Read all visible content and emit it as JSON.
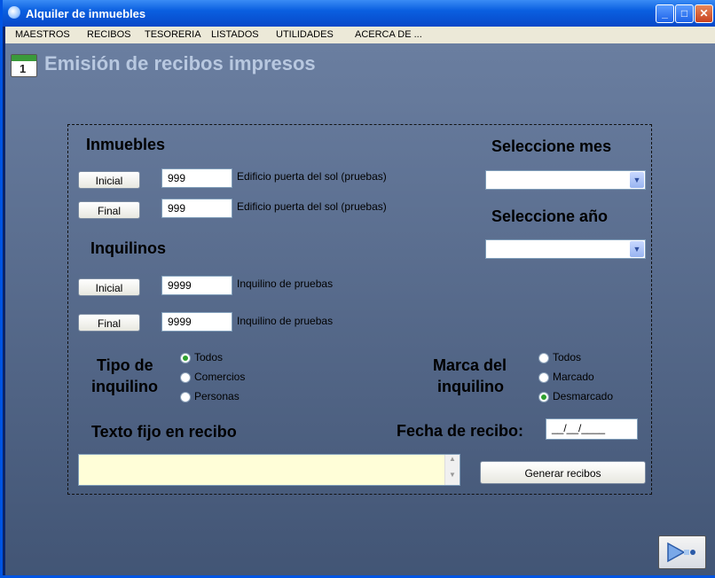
{
  "window": {
    "title": "Alquiler de inmuebles"
  },
  "menu": [
    "MAESTROS",
    "RECIBOS",
    "TESORERIA",
    "LISTADOS",
    "UTILIDADES",
    "ACERCA DE ..."
  ],
  "page": {
    "title": "Emisión de recibos impresos",
    "calendar_number": "1"
  },
  "inmuebles": {
    "heading": "Inmuebles",
    "initial": {
      "button": "Inicial",
      "value": "999",
      "description": "Edificio puerta del sol (pruebas)"
    },
    "final": {
      "button": "Final",
      "value": "999",
      "description": "Edificio puerta del sol (pruebas)"
    }
  },
  "inquilinos": {
    "heading": "Inquilinos",
    "initial": {
      "button": "Inicial",
      "value": "9999",
      "description": "Inquilino de pruebas"
    },
    "final": {
      "button": "Final",
      "value": "9999",
      "description": "Inquilino de pruebas"
    }
  },
  "mes": {
    "label": "Seleccione mes",
    "value": ""
  },
  "anio": {
    "label": "Seleccione año",
    "value": ""
  },
  "tipo": {
    "label_line1": "Tipo de",
    "label_line2": "inquilino",
    "options": [
      "Todos",
      "Comercios",
      "Personas"
    ],
    "selected": "Todos"
  },
  "marca": {
    "label_line1": "Marca del",
    "label_line2": "inquilino",
    "options": [
      "Todos",
      "Marcado",
      "Desmarcado"
    ],
    "selected": "Desmarcado"
  },
  "texto_fijo": {
    "label": "Texto fijo en recibo",
    "value": ""
  },
  "fecha": {
    "label": "Fecha de recibo:",
    "value": "__/__/____"
  },
  "generar": {
    "label": "Generar recibos"
  },
  "colors": {
    "accent": "#2ea02e",
    "heading": "#b8c8e0",
    "textarea_bg": "#fffed8"
  }
}
